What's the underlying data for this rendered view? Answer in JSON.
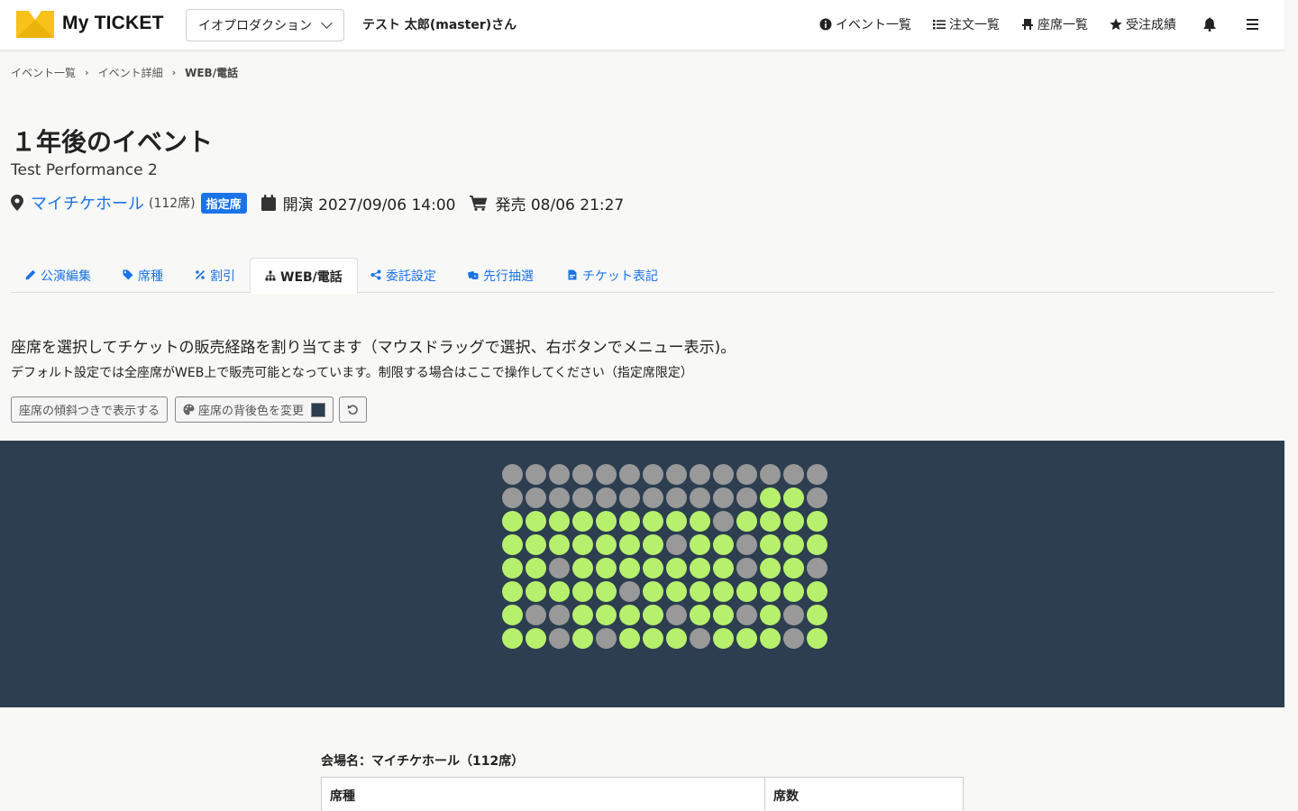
{
  "header": {
    "brand": "My TICKET",
    "org_select": "イオプロダクション",
    "user": "テスト 太郎(master)さん",
    "nav": {
      "events": "イベント一覧",
      "orders": "注文一覧",
      "seats": "座席一覧",
      "sales": "受注成績"
    },
    "brand_colors": {
      "logo_yellow": "#f7c21a",
      "link": "#1a73e8"
    }
  },
  "breadcrumb": [
    "イベント一覧",
    "イベント詳細",
    "WEB/電話"
  ],
  "event": {
    "title": "１年後のイベント",
    "subtitle": "Test Performance 2",
    "venue": "マイチケホール",
    "seat_count": "(112席)",
    "badge": "指定席",
    "performance": "開演 2027/09/06 14:00",
    "sale": "発売 08/06 21:27"
  },
  "tabs": [
    "公演編集",
    "席種",
    "割引",
    "WEB/電話",
    "委託設定",
    "先行抽選",
    "チケット表記"
  ],
  "active_tab": "WEB/電話",
  "instructions": {
    "line1": "座席を選択してチケットの販売経路を割り当てます（マウスドラッグで選択、右ボタンでメニュー表示)。",
    "line2": "デフォルト設定では全座席がWEB上で販売可能となっています。制限する場合はここで操作してください（指定席限定）"
  },
  "buttons": {
    "tilt": "座席の傾斜つきで表示する",
    "bg_color": "座席の背後色を変更"
  },
  "seatmap": {
    "colors": {
      "available": "#b7f06c",
      "unavailable": "#999999",
      "background": "#2c3e50"
    },
    "rows": [
      "GGGGGGGGGGGGGG",
      "GGGGGGGGGGGAAG",
      "AAAAAAAAAGAAAA",
      "AAAAAAAGAAGAAA",
      "AAGAAAAAAAGAAG",
      "AAAAAGAAAAAAAA",
      "AGGAAAAGAAGAGA",
      "AAGAGAAAGAAAGA"
    ]
  },
  "venue_table": {
    "label": "会場名：マイチケホール（112席）",
    "headers": [
      "席種",
      "席数"
    ]
  }
}
